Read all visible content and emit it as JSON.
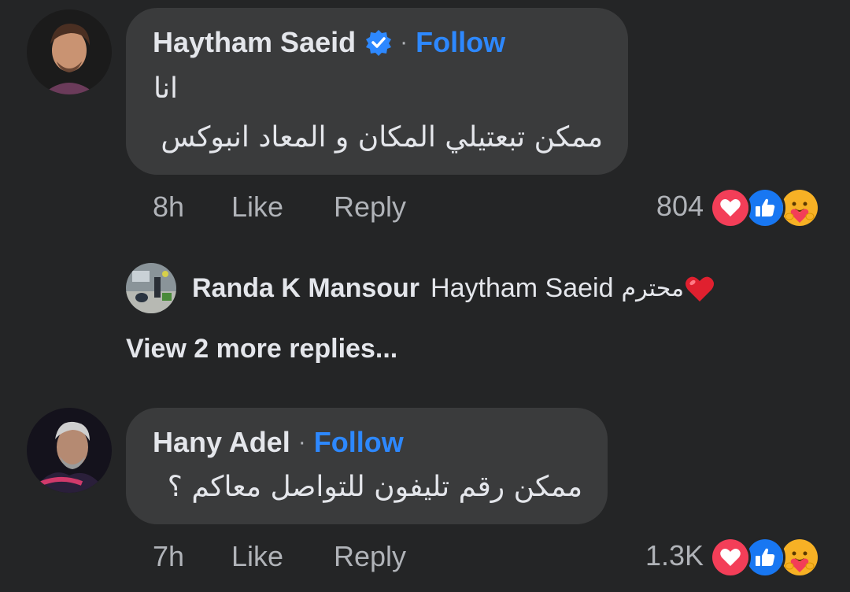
{
  "comments": [
    {
      "author": "Haytham Saeid",
      "verified": true,
      "separator": "·",
      "follow_label": "Follow",
      "lines": [
        "انا",
        "ممكن تبعتيلي المكان و المعاد انبوكس"
      ],
      "time": "8h",
      "like_label": "Like",
      "reply_label": "Reply",
      "reaction_count": "804",
      "reactions": [
        "love-icon",
        "like-icon",
        "care-icon"
      ]
    },
    {
      "author": "Hany Adel",
      "verified": false,
      "separator": "·",
      "follow_label": "Follow",
      "lines": [
        "ممكن  رقم تليفون للتواصل معاكم ؟"
      ],
      "time": "7h",
      "like_label": "Like",
      "reply_label": "Reply",
      "reaction_count": "1.3K",
      "reactions": [
        "love-icon",
        "like-icon",
        "care-icon"
      ]
    }
  ],
  "reply_preview": {
    "author": "Randa K Mansour",
    "mention": "Haytham Saeid",
    "text": "محترم",
    "emoji": "red-heart-icon"
  },
  "view_more_label": "View 2 more replies...",
  "colors": {
    "background": "#242526",
    "bubble": "#3a3b3c",
    "follow": "#2d88ff",
    "love": "#f33e58",
    "like": "#1877f2",
    "care": "#f7b125"
  }
}
